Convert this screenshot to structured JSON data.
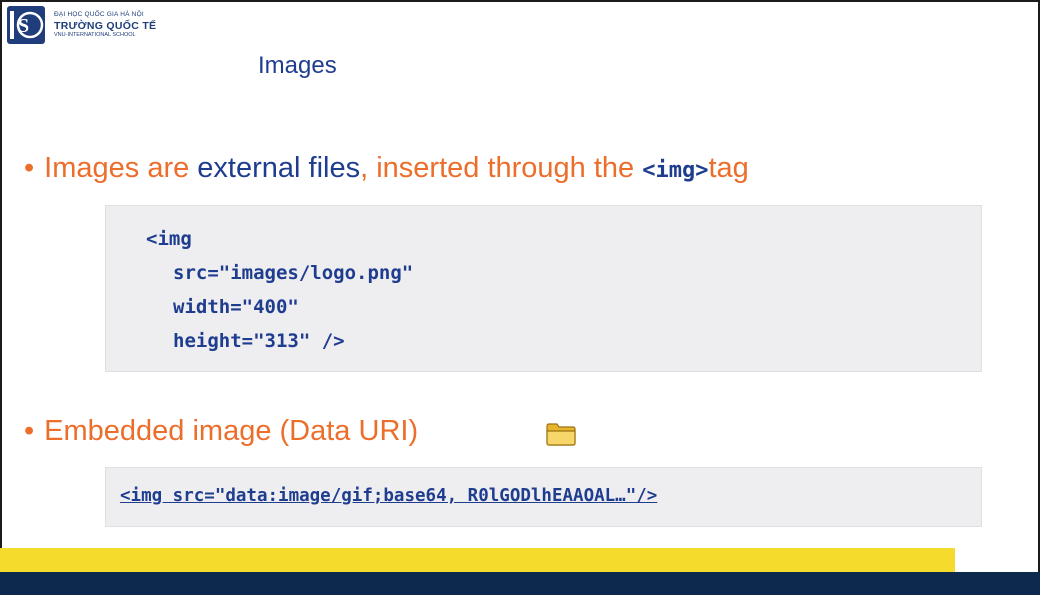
{
  "logo": {
    "line1": "ĐẠI HỌC QUỐC GIA HÀ NỘI",
    "line2": "TRƯỜNG QUỐC TẾ",
    "line3": "VNU-INTERNATIONAL SCHOOL",
    "mark": "IS"
  },
  "slide": {
    "title": "Images",
    "bullet1": {
      "part1": "Images are ",
      "part2": "external files",
      "part3": ", inserted through the ",
      "code": "<img>",
      "part4": "tag"
    },
    "code_block": {
      "line1": "<img",
      "line2": "src=\"images/logo.png\"",
      "line3": "width=\"400\"",
      "line4": "height=\"313\" />"
    },
    "bullet2": {
      "text": "Embedded image (Data URI)",
      "icon": "folder-icon"
    },
    "code_block2": "<img src=\"data:image/gif;base64, R0lGODlhEAAOAL…\"/>"
  },
  "colors": {
    "orange": "#ec6e2b",
    "navy": "#1f3d8f",
    "yellow": "#f5db2c",
    "footer": "#0d2a4e",
    "code_bg": "#eeeef1"
  }
}
